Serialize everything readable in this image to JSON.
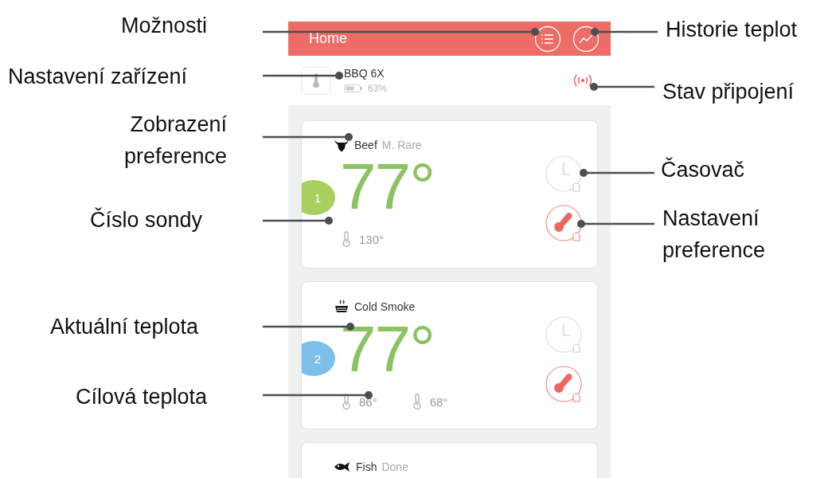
{
  "app": {
    "header": {
      "title": "Home"
    },
    "device": {
      "name": "BBQ 6X",
      "battery": "63%"
    },
    "probes": [
      {
        "kind": "bull",
        "number": "1",
        "color": "#a9d05f",
        "food": "Beef",
        "doneness": "M. Rare",
        "temperature": "77°",
        "readings": [
          "130°"
        ]
      },
      {
        "kind": "smoke",
        "number": "2",
        "color": "#7dbfe8",
        "food": "Cold Smoke",
        "temperature": "77°",
        "readings": [
          "86°",
          "68°"
        ]
      },
      {
        "kind": "fish",
        "food": "Fish",
        "doneness": "Done"
      }
    ]
  },
  "annotations": [
    {
      "label": "Možnosti"
    },
    {
      "label": "Historie teplot"
    },
    {
      "label": "Nastavení zařízení"
    },
    {
      "label": "Stav připojení"
    },
    {
      "label": "Zobrazení preference"
    },
    {
      "label": "Časovač"
    },
    {
      "label": "Číslo sondy"
    },
    {
      "label": "Nastavení preference"
    },
    {
      "label": "Aktuální teplota"
    },
    {
      "label": "Cílová teplota"
    }
  ]
}
